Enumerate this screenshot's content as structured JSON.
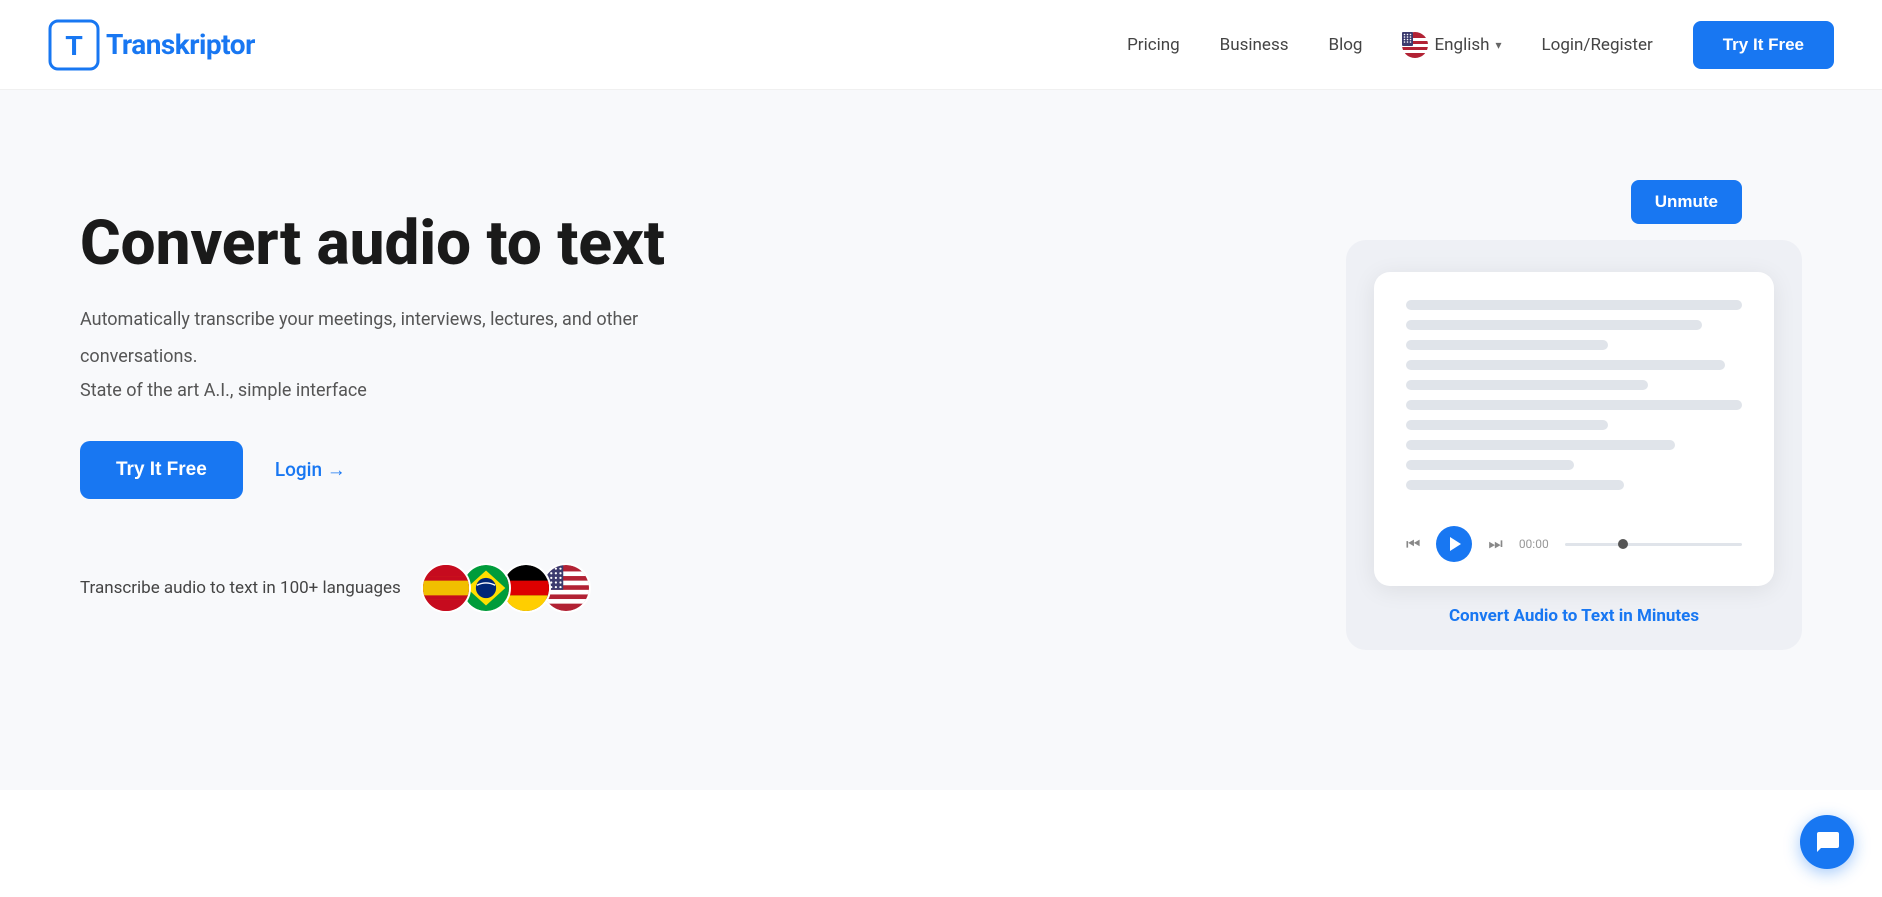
{
  "header": {
    "logo_text_regular": "ranskriptor",
    "logo_text_bold": "T",
    "nav": {
      "pricing": "Pricing",
      "business": "Business",
      "blog": "Blog",
      "language": "English",
      "login_register": "Login/Register",
      "try_free": "Try It Free"
    }
  },
  "hero": {
    "title": "Convert audio to text",
    "subtitle1": "Automatically transcribe your meetings, interviews, lectures, and other",
    "subtitle2": "conversations.",
    "subtitle3": "State of the art A.I., simple interface",
    "cta_primary": "Try It Free",
    "cta_secondary": "Login →",
    "languages_text": "Transcribe audio to text in 100+ languages",
    "flags": [
      "🇪🇸",
      "🇧🇷",
      "🇩🇪",
      "🇺🇸"
    ]
  },
  "card": {
    "unmute_label": "Unmute",
    "caption": "Convert Audio to Text in Minutes",
    "player_time": "00:00"
  },
  "chat": {
    "icon": "chat-icon"
  }
}
